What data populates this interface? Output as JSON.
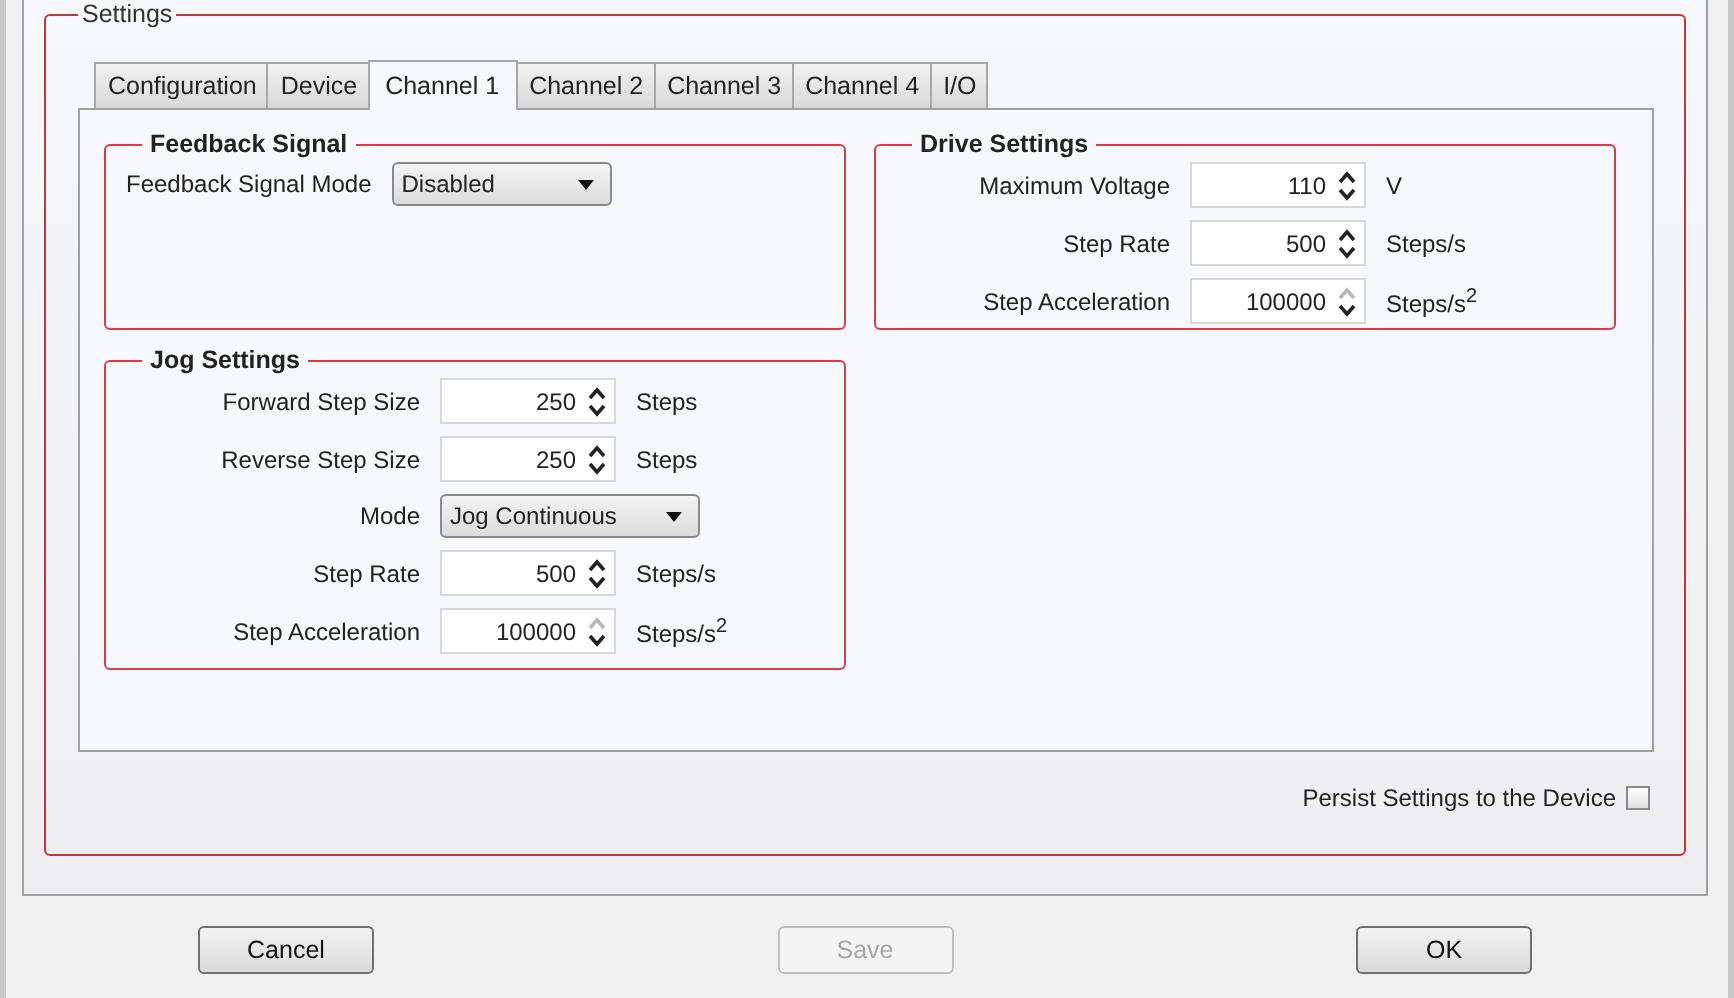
{
  "settings": {
    "title": "Settings",
    "tabs": [
      {
        "label": "Configuration",
        "selected": false
      },
      {
        "label": "Device",
        "selected": false
      },
      {
        "label": "Channel 1",
        "selected": true
      },
      {
        "label": "Channel 2",
        "selected": false
      },
      {
        "label": "Channel 3",
        "selected": false
      },
      {
        "label": "Channel 4",
        "selected": false
      },
      {
        "label": "I/O",
        "selected": false
      }
    ],
    "groups": [
      {
        "title": "Feedback Signal",
        "fields": [
          {
            "kind": "select",
            "label": "Feedback Signal Mode",
            "value": "Disabled"
          }
        ]
      },
      {
        "title": "Drive Settings",
        "fields": [
          {
            "kind": "spin",
            "label": "Maximum Voltage",
            "value": "110",
            "unit": "V",
            "up_disabled": false
          },
          {
            "kind": "spin",
            "label": "Step Rate",
            "value": "500",
            "unit": "Steps/s",
            "up_disabled": false
          },
          {
            "kind": "spin",
            "label": "Step Acceleration",
            "value": "100000",
            "unit": "Steps/s$^{2}$",
            "up_disabled": true
          }
        ]
      },
      {
        "title": "Jog Settings",
        "fields": [
          {
            "kind": "spin",
            "label": "Forward Step Size",
            "value": "250",
            "unit": "Steps",
            "up_disabled": false
          },
          {
            "kind": "spin",
            "label": "Reverse Step Size",
            "value": "250",
            "unit": "Steps",
            "up_disabled": false
          },
          {
            "kind": "select",
            "label": "Mode",
            "value": "Jog Continuous"
          },
          {
            "kind": "spin",
            "label": "Step Rate",
            "value": "500",
            "unit": "Steps/s",
            "up_disabled": false
          },
          {
            "kind": "spin",
            "label": "Step Acceleration",
            "value": "100000",
            "unit": "Steps/s$^{2}$",
            "up_disabled": true
          }
        ]
      }
    ],
    "persist": {
      "label": "Persist Settings to the Device",
      "checked": false
    }
  },
  "buttons": [
    {
      "label": "Cancel",
      "disabled": false
    },
    {
      "label": "Save",
      "disabled": true
    },
    {
      "label": "OK",
      "disabled": false
    }
  ]
}
